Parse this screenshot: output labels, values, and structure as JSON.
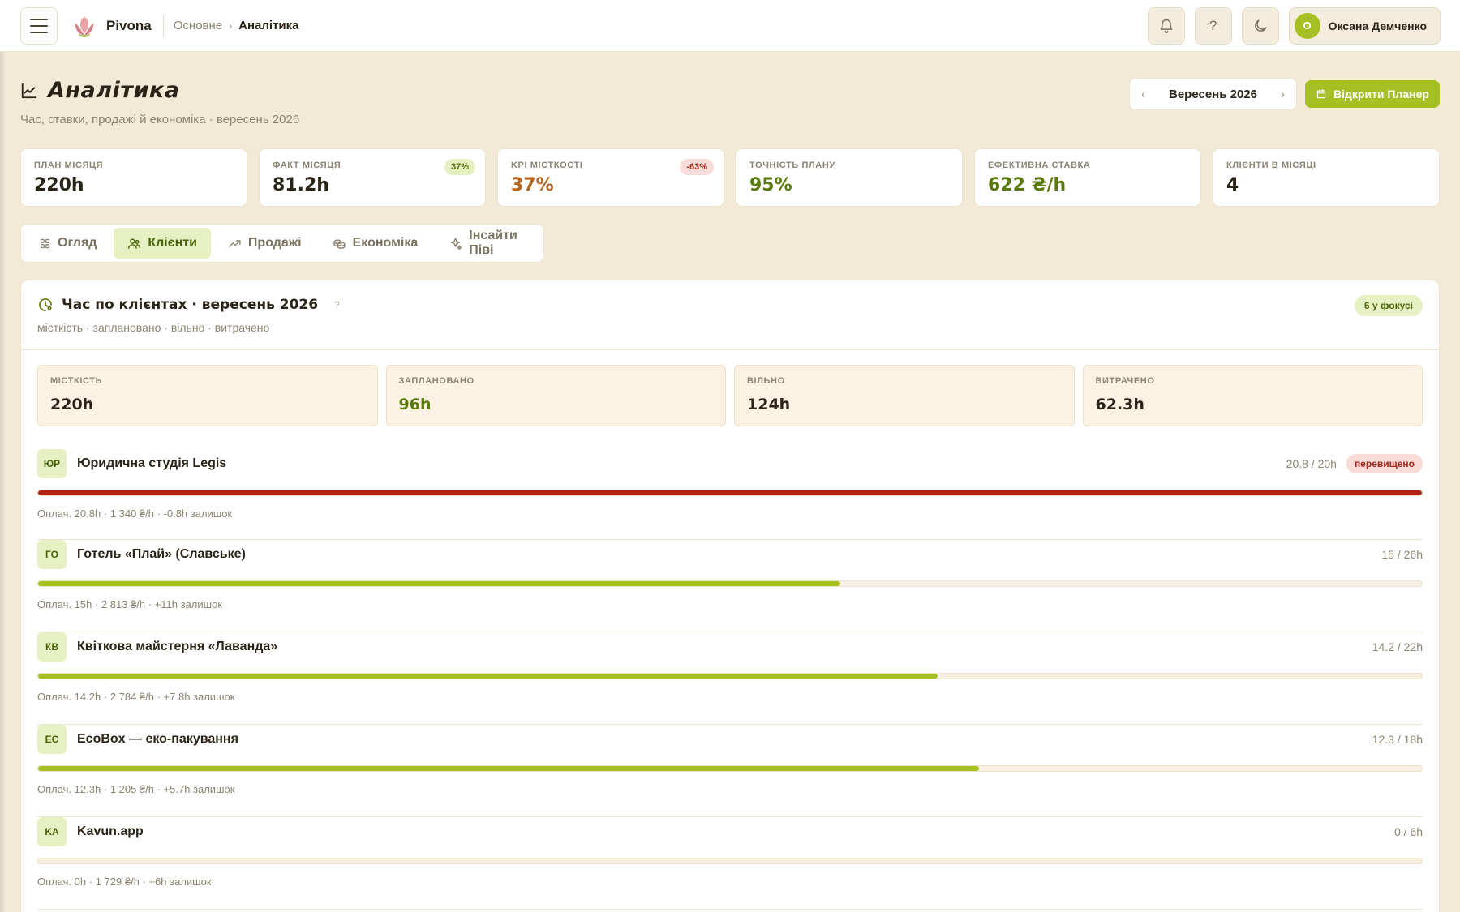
{
  "app": {
    "name": "Pivona"
  },
  "breadcrumb": {
    "parent": "Основне",
    "current": "Аналітика"
  },
  "topbar": {
    "help_label": "?",
    "user_initial": "О",
    "user_name": "Оксана Демченко"
  },
  "header": {
    "title": "Аналітика",
    "subtitle": "Час, ставки, продажі й економіка · вересень 2026",
    "month": "Вересень 2026",
    "open_planner": "Відкрити Планер"
  },
  "kpis": [
    {
      "label": "План місяця",
      "value": "220h",
      "badge": ""
    },
    {
      "label": "Факт місяця",
      "value": "81.2h",
      "badge": "37%"
    },
    {
      "label": "KPI місткості",
      "value": "37%",
      "badge": "-63%"
    },
    {
      "label": "Точність плану",
      "value": "95%",
      "badge": ""
    },
    {
      "label": "Ефективна ставка",
      "value": "622 ₴/h",
      "badge": ""
    },
    {
      "label": "Клієнти в місяці",
      "value": "4",
      "badge": ""
    }
  ],
  "tabs": [
    {
      "label": "Огляд",
      "icon": "grid-icon"
    },
    {
      "label": "Клієнти",
      "icon": "users-icon",
      "active": true
    },
    {
      "label": "Продажі",
      "icon": "trend-icon"
    },
    {
      "label": "Економіка",
      "icon": "coins-icon"
    },
    {
      "label": "Інсайти Піві",
      "icon": "sparkle-icon"
    }
  ],
  "panel": {
    "title": "Час по клієнтах · вересень 2026",
    "help": "?",
    "subtitle": "місткість · заплановано · вільно · витрачено",
    "focus_badge": "6 у фокусі",
    "stats": [
      {
        "label": "Місткість",
        "value": "220h"
      },
      {
        "label": "Заплановано",
        "value": "96h"
      },
      {
        "label": "Вільно",
        "value": "124h"
      },
      {
        "label": "Витрачено",
        "value": "62.3h"
      }
    ],
    "clients": [
      {
        "initials": "ЮР",
        "name": "Юридична студія Legis",
        "hours": "20.8 / 20h",
        "over": "перевищено",
        "progress": 1.0,
        "meta": "Оплач. 20.8h · 1 340 ₴/h · -0.8h залишок"
      },
      {
        "initials": "ГО",
        "name": "Готель «Плай» (Славське)",
        "hours": "15 / 26h",
        "over": "",
        "progress": 0.58,
        "meta": "Оплач. 15h · 2 813 ₴/h · +11h залишок"
      },
      {
        "initials": "КВ",
        "name": "Квіткова майстерня «Лаванда»",
        "hours": "14.2 / 22h",
        "over": "",
        "progress": 0.65,
        "meta": "Оплач. 14.2h · 2 784 ₴/h · +7.8h залишок"
      },
      {
        "initials": "EC",
        "name": "EcoBox — еко-пакування",
        "hours": "12.3 / 18h",
        "over": "",
        "progress": 0.68,
        "meta": "Оплач. 12.3h · 1 205 ₴/h · +5.7h залишок"
      },
      {
        "initials": "KA",
        "name": "Kavun.app",
        "hours": "0 / 6h",
        "over": "",
        "progress": 0.0,
        "meta": "Оплач. 0h · 1 729 ₴/h · +6h залишок"
      }
    ]
  },
  "colors": {
    "accent": "#a6bf22",
    "danger": "#b01e14",
    "background": "#f2ead6"
  }
}
